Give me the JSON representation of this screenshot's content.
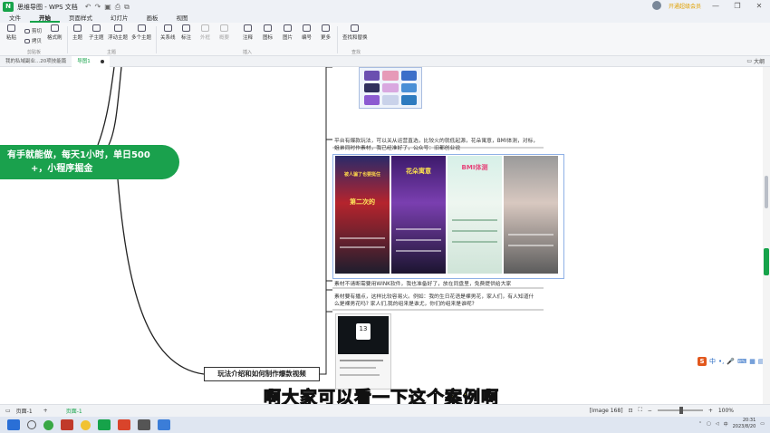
{
  "app": {
    "logo": "N",
    "title": "思维导图 - WPS 文档",
    "window_controls": [
      "—",
      "❐",
      "✕"
    ],
    "ribbon_toggle": "⌃",
    "vip_text": "开通超级会员"
  },
  "menu": {
    "items": [
      "文件",
      "开始",
      "页面样式",
      "幻灯片",
      "画板",
      "视图"
    ],
    "active": "开始"
  },
  "ribbon": {
    "groups": [
      {
        "label": "剪贴板"
      },
      {
        "label": "主题"
      },
      {
        "label": "插入"
      },
      {
        "label": "查找"
      }
    ],
    "clipboard": {
      "paste": "粘贴",
      "cut": "剪切",
      "copy": "拷贝",
      "format_painter": "格式刷"
    },
    "topic": {
      "main_topic": "主题",
      "sub_topic": "子主题",
      "float_topic": "浮动主题",
      "multi_topic": "多个主题"
    },
    "insert": {
      "relation": "关系线",
      "label": "标注",
      "outline": "外框",
      "summary": "概要",
      "note": "注释",
      "icon": "图标",
      "image": "图片",
      "number": "编号",
      "more": "更多"
    },
    "find": {
      "find_replace": "查找和替换"
    }
  },
  "tabs": {
    "items": [
      "我的私域副业...20项技能篇",
      "导图1"
    ],
    "active": "导图1",
    "outline": "大纲"
  },
  "canvas": {
    "green_node_line1": "有手就能做，每天1小时，单日500",
    "green_node_line2": "+，小程序掘金",
    "topic_node": "玩法介绍和如何制作爆款视频",
    "note1_line1": "平台有爆款玩法，可以关从运营直选，比较火的就低起源，花朵寓意，BMI体测，对标，",
    "note1_line2": "姐弟同时作素材，我已经准好了，公众号：旧都创业说",
    "shot1_cap": "被人骗了也要挺住",
    "shot1_cap2": "第二次的",
    "shot2_cap": "花朵寓意",
    "shot3_cap": "BMI体测",
    "shot4_cap": "",
    "note2": "素材不请断需要用WINK软件，我也准备好了，放在同盘里，免费提供给大家",
    "note3_line1": "素材要有播点，这样比较容易火。例如：我的生日花语是裸男花，家人们，有人知道什",
    "note3_line2": "么是裸男花吗?     家人们,我的组来是谁尤，你们的组来是谁呢?",
    "phone_cal": "13"
  },
  "subtitle": "啊大家可以看一下这个案例啊",
  "status": {
    "page_label": "页面-1",
    "add": "+",
    "sheet": "页面-1",
    "image_info": "[Image 168]",
    "zoom": "100%"
  },
  "taskbar": {
    "time": "20:31",
    "date": "2023/8/20"
  },
  "ime": {
    "logo": "S",
    "lang": "中"
  }
}
